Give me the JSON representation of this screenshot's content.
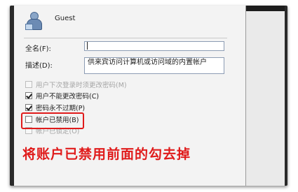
{
  "user": {
    "name": "Guest"
  },
  "fields": {
    "full_name": {
      "label": "全名(F):",
      "value": ""
    },
    "description": {
      "label": "描述(D):",
      "value": "供来宾访问计算机或访问域的内置帐户"
    }
  },
  "options": [
    {
      "label": "用户下次登录时须更改密码(M)",
      "checked": false,
      "disabled": true
    },
    {
      "label": "用户不能更改密码(C)",
      "checked": true,
      "disabled": false
    },
    {
      "label": "密码永不过期(P)",
      "checked": true,
      "disabled": false
    },
    {
      "label": "帐户已禁用(B)",
      "checked": false,
      "disabled": false
    },
    {
      "label": "帐户已锁定(O)",
      "checked": false,
      "disabled": true
    }
  ],
  "annotation": {
    "text": "将账户已禁用前面的勾去掉",
    "color": "#e01b1b"
  }
}
